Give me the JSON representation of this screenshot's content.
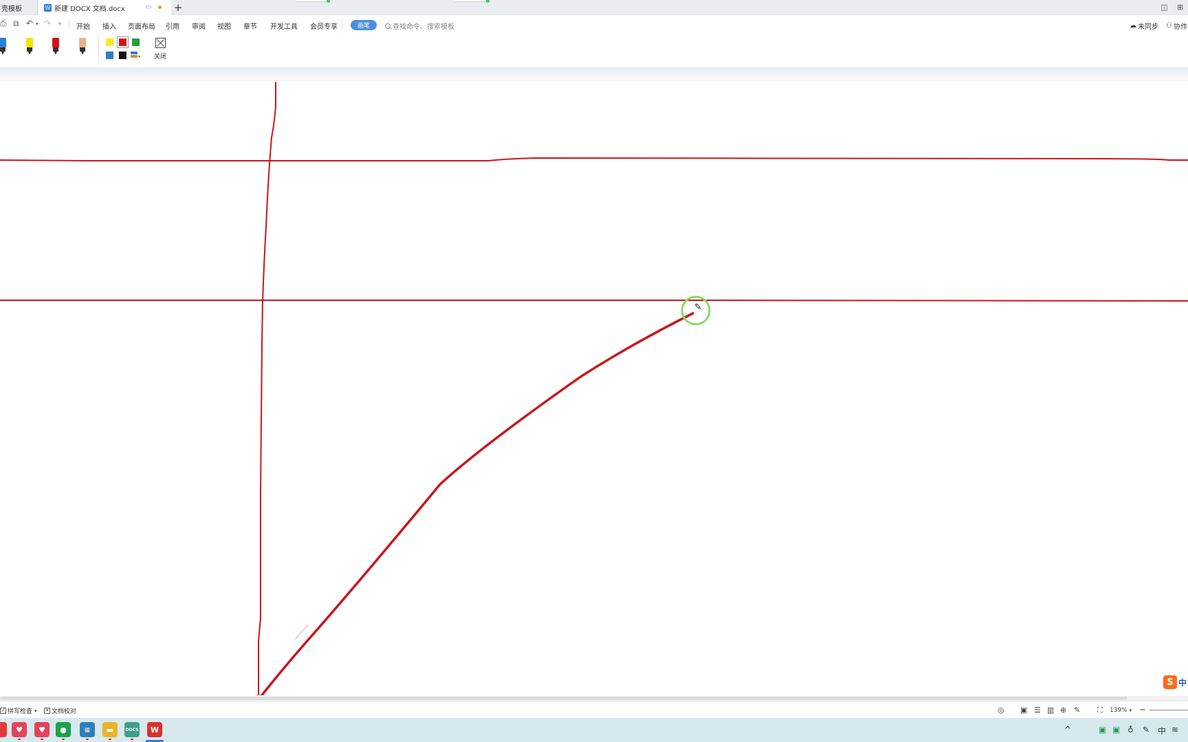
{
  "tabs": {
    "inactive_label": "壳模板",
    "active_label": "新建 DOCX 文档.docx",
    "active_icon": "word-doc-icon",
    "new_tab_label": "+"
  },
  "window": {
    "layout_icon": "◫",
    "grid_icon": "⊞"
  },
  "menu": {
    "items": [
      "开始",
      "插入",
      "页面布局",
      "引用",
      "审阅",
      "视图",
      "章节",
      "开发工具",
      "会员专享"
    ],
    "active_tab": "画笔",
    "search_placeholder": "查找命令、搜索模板",
    "sync_label": "未同步",
    "collab_label": "协作"
  },
  "ribbon": {
    "pens": [
      {
        "name": "pen-blue",
        "color": "#2b7ee0"
      },
      {
        "name": "highlighter-yellow",
        "color": "#f5e400"
      },
      {
        "name": "marker-red",
        "color": "#d0121b"
      },
      {
        "name": "pencil-tan",
        "color": "#e9b48a"
      }
    ],
    "colors": [
      {
        "name": "yellow",
        "hex": "#f7e92a",
        "selected": false
      },
      {
        "name": "red",
        "hex": "#d41414",
        "selected": true
      },
      {
        "name": "green",
        "hex": "#22a03a",
        "selected": false
      },
      {
        "name": "blue",
        "hex": "#2b7ec9",
        "selected": false
      },
      {
        "name": "black",
        "hex": "#111111",
        "selected": false
      }
    ],
    "close_label": "关闭"
  },
  "ink": {
    "color": "#c8171c"
  },
  "status": {
    "spellcheck_label": "拼写检查",
    "spellcheck_caret": "▾",
    "proofread_label": "文档校对",
    "zoom_label": "139%",
    "zoom_caret": "▾"
  },
  "taskbar": {
    "apps": [
      {
        "name": "app-red-partial",
        "color": "#e23a3a",
        "glyph": ""
      },
      {
        "name": "app-health-1",
        "color": "#e0455a",
        "glyph": "♥"
      },
      {
        "name": "app-health-2",
        "color": "#e0455a",
        "glyph": "♥"
      },
      {
        "name": "app-chat",
        "color": "#1aa34a",
        "glyph": "●"
      },
      {
        "name": "app-notes",
        "color": "#2e7fb8",
        "glyph": "≡"
      },
      {
        "name": "app-folder",
        "color": "#e8b52c",
        "glyph": "▬"
      },
      {
        "name": "app-docs",
        "color": "#3f9e8a",
        "glyph": "▦"
      },
      {
        "name": "app-wps",
        "color": "#d6322f",
        "glyph": "W"
      }
    ],
    "docs_badge": "DOCS",
    "tray_ime": "中",
    "tray_up": "^"
  }
}
